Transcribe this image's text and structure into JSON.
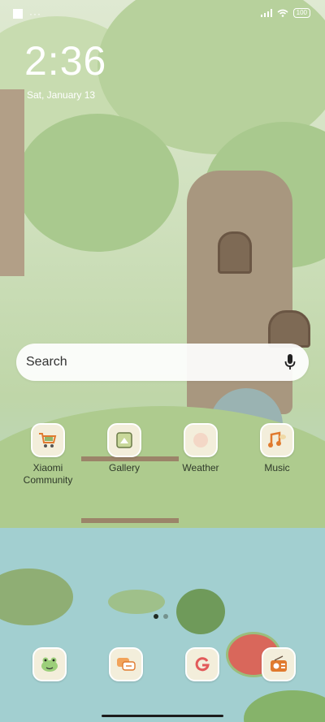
{
  "status_bar": {
    "left_dots": "···",
    "battery": "100"
  },
  "lockscreen": {
    "time": "2:36",
    "date": "Sat, January 13"
  },
  "search": {
    "placeholder": "Search"
  },
  "apps": [
    {
      "label": "Xiaomi Community",
      "icon": "xiaomi-community-icon"
    },
    {
      "label": "Gallery",
      "icon": "gallery-icon"
    },
    {
      "label": "Weather",
      "icon": "weather-icon"
    },
    {
      "label": "Music",
      "icon": "music-icon"
    }
  ],
  "dock": [
    {
      "icon": "frog-app-icon"
    },
    {
      "icon": "messages-icon"
    },
    {
      "icon": "google-icon"
    },
    {
      "icon": "radio-icon"
    }
  ],
  "page_indicator": {
    "pages": 2,
    "current": 1
  },
  "colors": {
    "accent": "#e07a2e",
    "sky": "#dfe9d2",
    "water": "#a9d3cf",
    "tree": "#9c8a72"
  }
}
